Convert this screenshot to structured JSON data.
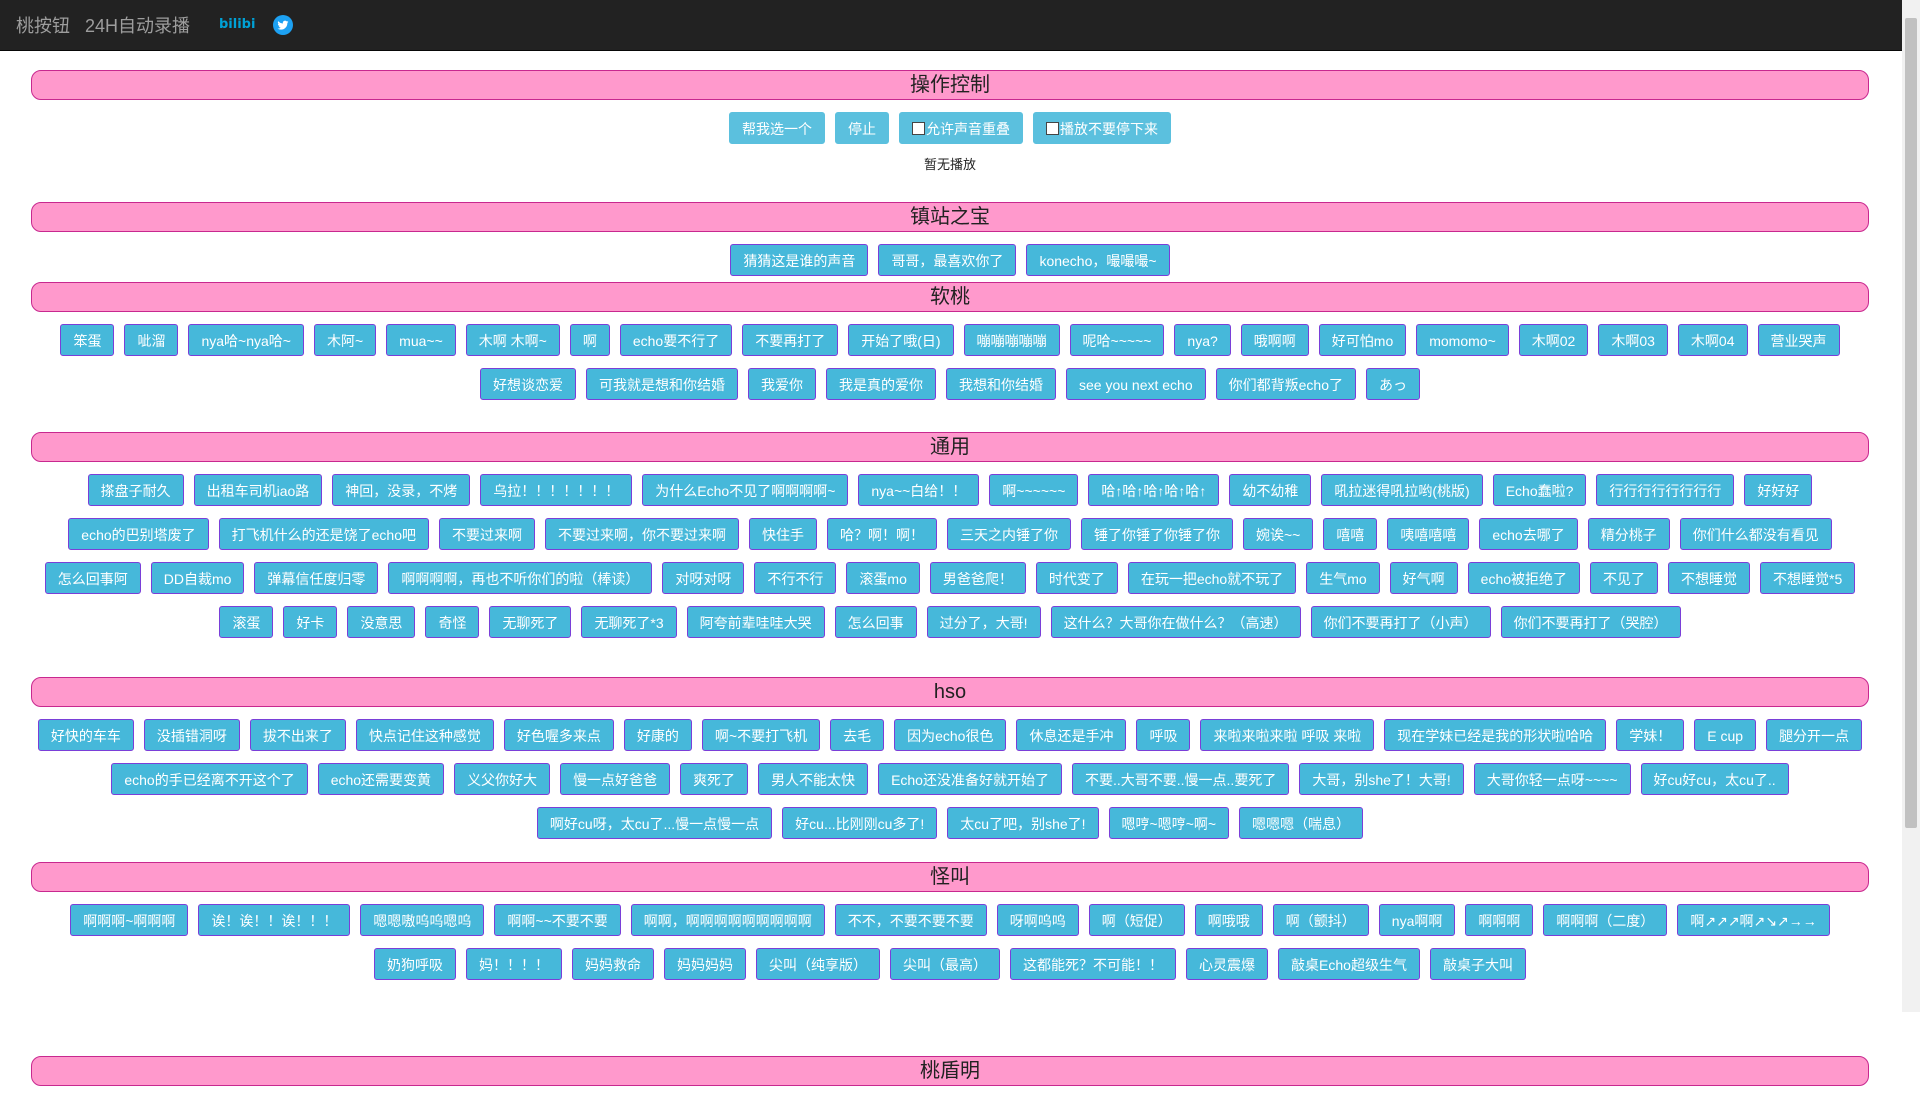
{
  "nav": {
    "brand": "桃按钮",
    "live": "24H自动录播",
    "bili_label": "bilibili"
  },
  "sections": [
    {
      "title": "操作控制",
      "type": "control",
      "buttons": [
        {
          "label": "帮我选一个"
        },
        {
          "label": "停止"
        },
        {
          "label": "允许声音重叠",
          "checkbox": true
        },
        {
          "label": "播放不要停下来",
          "checkbox": true
        }
      ],
      "status": "暂无播放"
    },
    {
      "title": "镇站之宝",
      "buttons": [
        "猜猜这是谁的声音",
        "哥哥，最喜欢你了",
        "konecho，嘬嘬嘬~"
      ]
    },
    {
      "title": "软桃",
      "buttons": [
        "笨蛋",
        "呲溜",
        "nya哈~nya哈~",
        "木阿~",
        "mua~~",
        "木啊 木啊~",
        "啊",
        "echo要不行了",
        "不要再打了",
        "开始了哦(日)",
        "嘣嘣嘣嘣嘣",
        "呢哈~~~~~",
        "nya?",
        "哦啊啊",
        "好可怕mo",
        "momomo~",
        "木啊02",
        "木啊03",
        "木啊04",
        "营业哭声",
        "好想谈恋爱",
        "可我就是想和你结婚",
        "我爱你",
        "我是真的爱你",
        "我想和你结婚",
        "see you next echo",
        "你们都背叛echo了",
        "あっ"
      ]
    },
    {
      "title": "通用",
      "buttons": [
        "搽盘子耐久",
        "出租车司机iao路",
        "神回，没录，不烤",
        "乌拉！！！！！！！",
        "为什么Echo不见了啊啊啊啊~",
        "nya~~白给！！",
        "啊~~~~~~",
        "哈↑哈↑哈↑哈↑哈↑",
        "幼不幼稚",
        "吼拉迷得吼拉哟(桃版)",
        "Echo蠢啦?",
        "行行行行行行行行",
        "好好好",
        "echo的巴别塔废了",
        "打飞机什么的还是饶了echo吧",
        "不要过来啊",
        "不要过来啊，你不要过来啊",
        "快住手",
        "哈？啊！啊！",
        "三天之内锤了你",
        "锤了你锤了你锤了你",
        "婉诶~~",
        "嘻嘻",
        "咦嘻嘻嘻",
        "echo去哪了",
        "精分桃子",
        "你们什么都没有看见",
        "怎么回事阿",
        "DD自裁mo",
        "弹幕信任度归零",
        "啊啊啊啊，再也不听你们的啦（棒读）",
        "对呀对呀",
        "不行不行",
        "滚蛋mo",
        "男爸爸爬！",
        "时代变了",
        "在玩一把echo就不玩了",
        "生气mo",
        "好气啊",
        "echo被拒绝了",
        "不见了",
        "不想睡觉",
        "不想睡觉*5",
        "滚蛋",
        "好卡",
        "没意思",
        "奇怪",
        "无聊死了",
        "无聊死了*3",
        "阿夸前辈哇哇大哭",
        "怎么回事",
        "过分了，大哥!",
        "这什么？大哥你在做什么？（高速）",
        "你们不要再打了（小声）",
        "你们不要再打了（哭腔）"
      ]
    },
    {
      "title": "hso",
      "buttons": [
        "好快的车车",
        "没插错洞呀",
        "拔不出来了",
        "快点记住这种感觉",
        "好色喔多来点",
        "好康的",
        "啊~不要打飞机",
        "去毛",
        "因为echo很色",
        "休息还是手冲",
        "呼吸",
        "来啦来啦来啦 呼吸 来啦",
        "现在学妹已经是我的形状啦哈哈",
        "学妹！",
        "E cup",
        "腿分开一点",
        "echo的手已经离不开这个了",
        "echo还需要变黄",
        "义父你好大",
        "慢一点好爸爸",
        "爽死了",
        "男人不能太快",
        "Echo还没准备好就开始了",
        "不要..大哥不要..慢一点..要死了",
        "大哥，别she了！大哥!",
        "大哥你轻一点呀~~~~",
        "好cu好cu，太cu了..",
        "啊好cu呀，太cu了...慢一点慢一点",
        "好cu...比刚刚cu多了!",
        "太cu了吧，别she了!",
        "嗯哼~嗯哼~啊~",
        "嗯嗯嗯（喘息）"
      ]
    },
    {
      "title": "怪叫",
      "buttons": [
        "啊啊啊~啊啊啊",
        "诶！诶！！诶！！！",
        "嗯嗯嗷呜呜嗯呜",
        "啊啊~~不要不要",
        "啊啊，啊啊啊啊啊啊啊啊啊",
        "不不，不要不要不要",
        "呀啊呜呜",
        "啊（短促）",
        "啊哦哦",
        "啊（颤抖）",
        "nya啊啊",
        "啊啊啊",
        "啊啊啊（二度）",
        "啊↗↗↗啊↗↘↗→→",
        "奶狗呼吸",
        "妈！！！！",
        "妈妈救命",
        "妈妈妈妈",
        "尖叫（纯享版）",
        "尖叫（最高）",
        "这都能死？不可能！！",
        "心灵震爆",
        "敲桌Echo超级生气",
        "敲桌子大叫"
      ]
    },
    {
      "title": "桃盾明",
      "buttons": []
    }
  ]
}
